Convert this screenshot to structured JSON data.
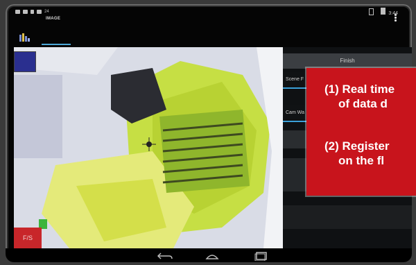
{
  "app": {
    "title": "IMAGE"
  },
  "status_bar": {
    "notification_count": "24",
    "time": "3:44"
  },
  "camera": {
    "top_left_button": "",
    "fs_button": "F/S"
  },
  "controls": {
    "finish": "Finish",
    "scene_button": "Scene F",
    "camwa_button": "Cam Wa"
  },
  "annotation": {
    "items": [
      {
        "line1": "(1) Real time",
        "line2": "of data d"
      },
      {
        "line1": "(2) Register",
        "line2": "on the fl"
      }
    ]
  },
  "colors": {
    "accent": "#3ba0d8",
    "annotation_bg": "#c8141c",
    "fs_button": "#c8262a"
  },
  "icons": [
    "overflow-menu-icon",
    "back-icon",
    "home-icon",
    "recents-icon"
  ]
}
